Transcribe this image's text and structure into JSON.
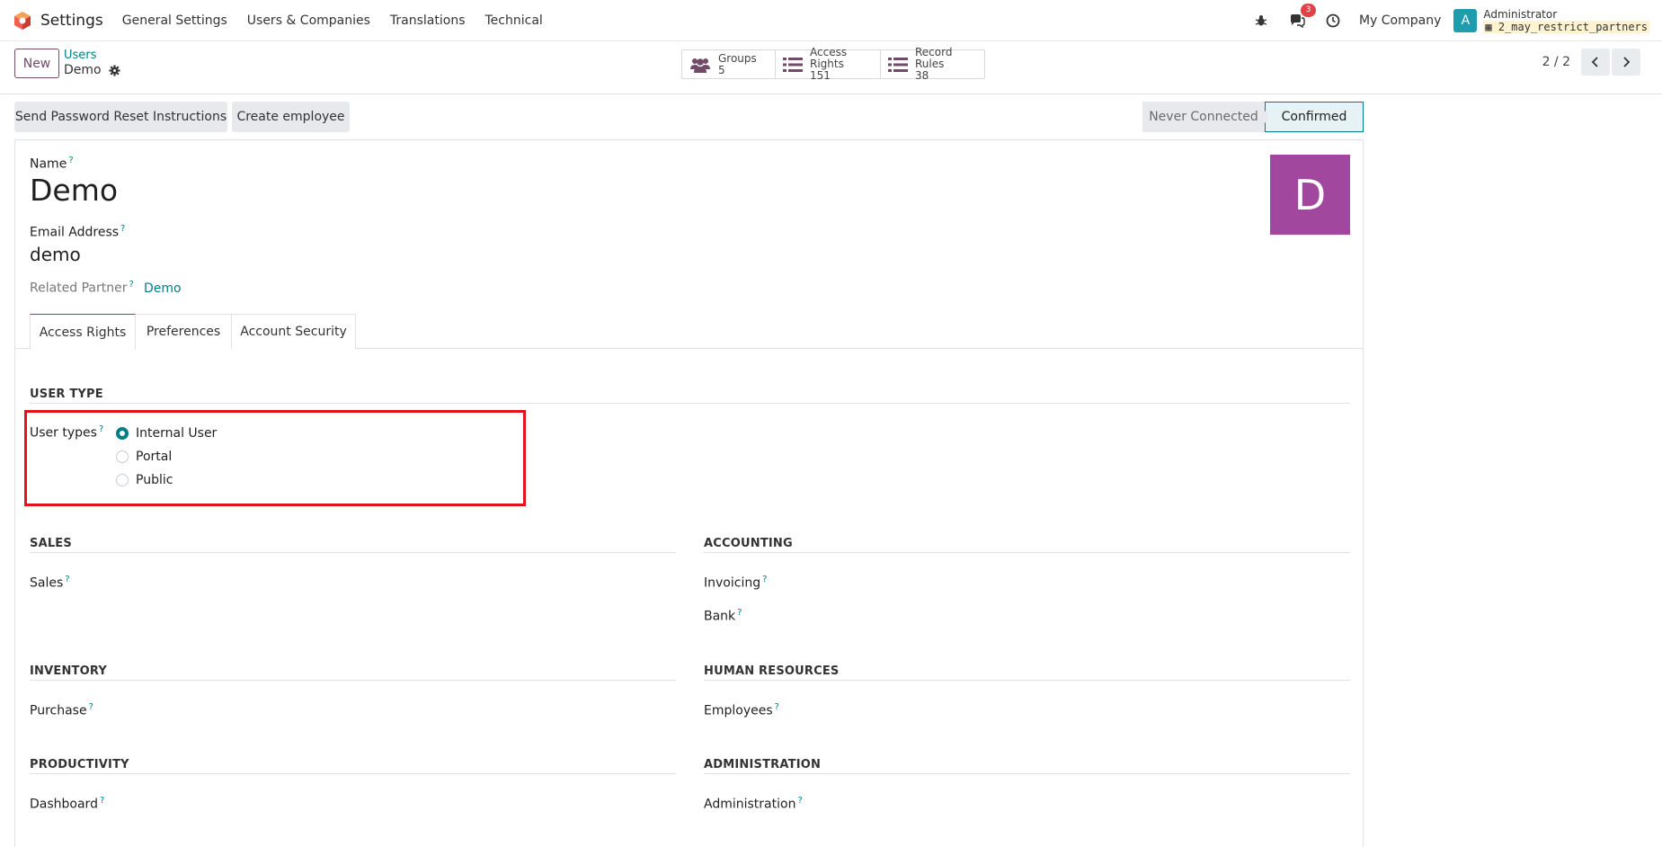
{
  "navbar": {
    "app_title": "Settings",
    "menu": [
      "General Settings",
      "Users & Companies",
      "Translations",
      "Technical"
    ],
    "message_count": "3",
    "company": "My Company",
    "user_initial": "A",
    "user_name": "Administrator",
    "db_name": "2_may_restrict_partners"
  },
  "control": {
    "new_label": "New",
    "breadcrumb_parent": "Users",
    "breadcrumb_current": "Demo",
    "smart_buttons": [
      {
        "label": "Groups",
        "count": "5",
        "icon": "users-icon"
      },
      {
        "label": "Access Rights",
        "count": "151",
        "icon": "list-icon"
      },
      {
        "label": "Record Rules",
        "count": "38",
        "icon": "list-icon"
      }
    ],
    "pager": "2 / 2"
  },
  "statusbar": {
    "reset_label": "Send Password Reset Instructions",
    "employee_label": "Create employee",
    "stages": [
      "Never Connected",
      "Confirmed"
    ],
    "active_stage": "Confirmed"
  },
  "form": {
    "name_label": "Name",
    "name_value": "Demo",
    "email_label": "Email Address",
    "email_value": "demo",
    "partner_label": "Related Partner",
    "partner_value": "Demo",
    "avatar_initial": "D",
    "avatar_color": "#a2479e",
    "help_mark": "?"
  },
  "tabs": [
    "Access Rights",
    "Preferences",
    "Account Security"
  ],
  "access": {
    "user_type_heading": "USER TYPE",
    "user_types_label": "User types",
    "user_types": [
      {
        "label": "Internal User",
        "selected": true
      },
      {
        "label": "Portal",
        "selected": false
      },
      {
        "label": "Public",
        "selected": false
      }
    ],
    "sections": {
      "sales": {
        "heading": "SALES",
        "fields": [
          "Sales"
        ]
      },
      "accounting": {
        "heading": "ACCOUNTING",
        "fields": [
          "Invoicing",
          "Bank"
        ]
      },
      "inventory": {
        "heading": "INVENTORY",
        "fields": [
          "Purchase"
        ]
      },
      "hr": {
        "heading": "HUMAN RESOURCES",
        "fields": [
          "Employees"
        ]
      },
      "productivity": {
        "heading": "PRODUCTIVITY",
        "fields": [
          "Dashboard"
        ]
      },
      "administration": {
        "heading": "ADMINISTRATION",
        "fields": [
          "Administration"
        ]
      }
    }
  },
  "colors": {
    "accent": "#017e84",
    "brand": "#714b67",
    "highlight": "#e4131b"
  }
}
